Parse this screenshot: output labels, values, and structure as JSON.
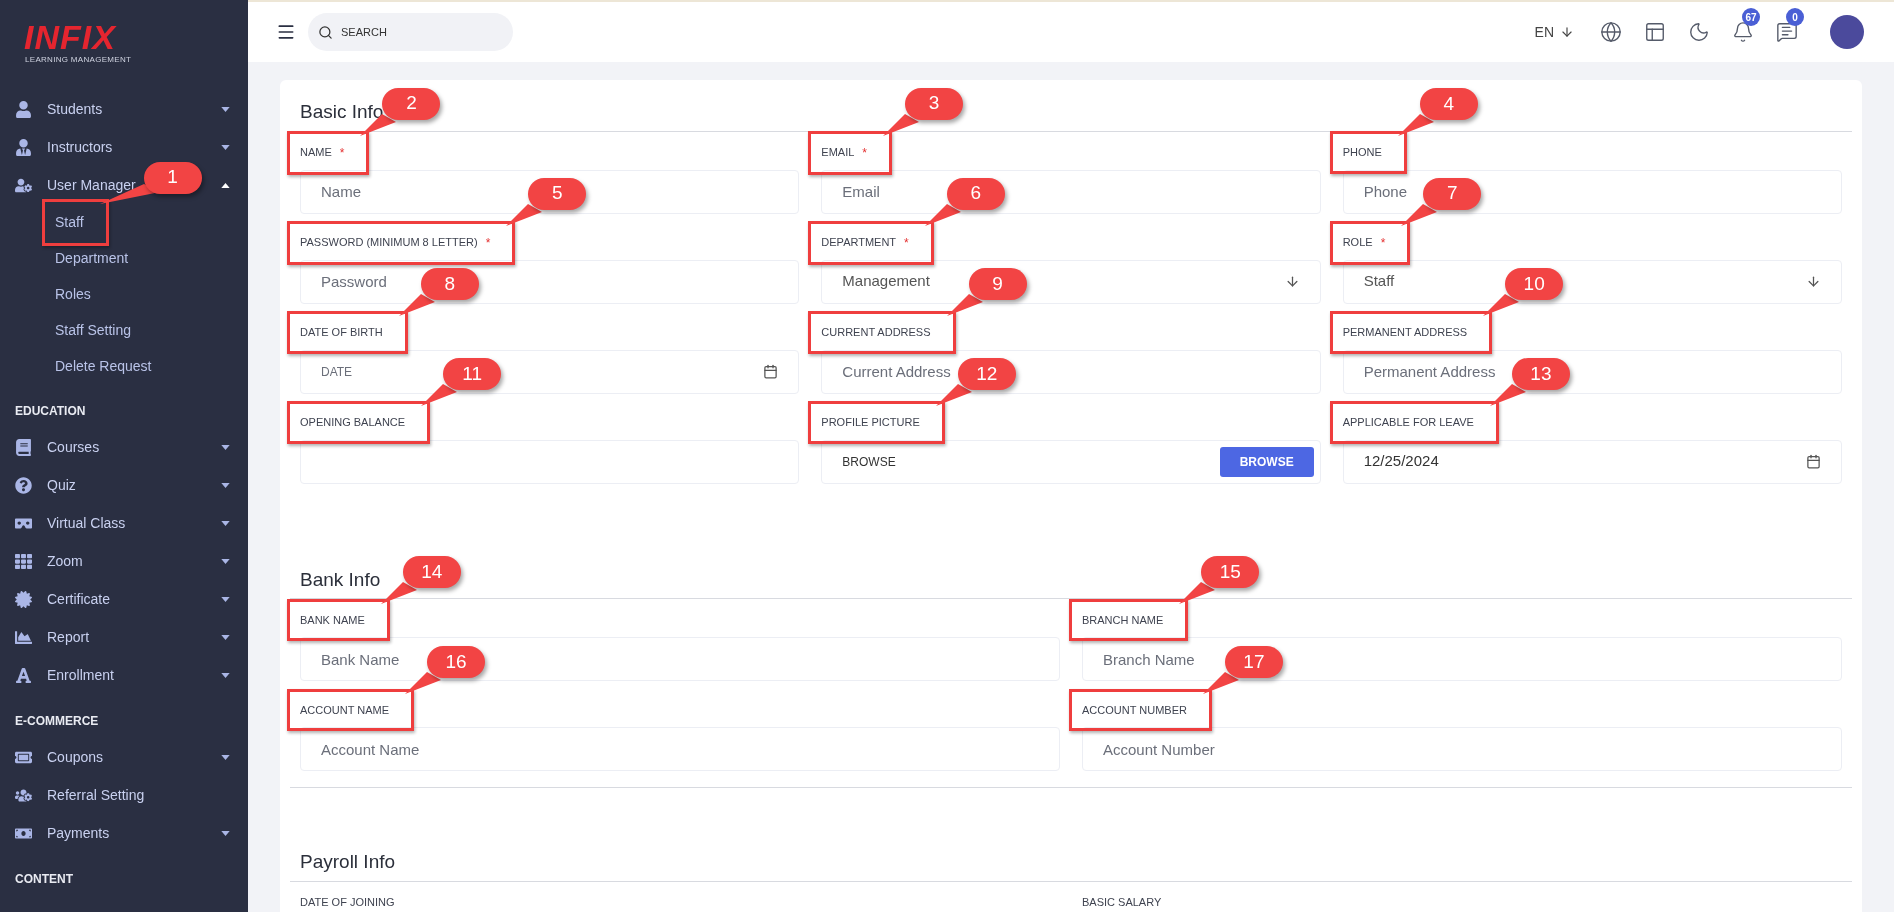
{
  "sidebar": {
    "logo": {
      "title": "INFIX",
      "subtitle": "LEARNING MANAGEMENT"
    },
    "items": [
      {
        "kind": "menu",
        "label": "Students",
        "expanded": false
      },
      {
        "kind": "menu",
        "label": "Instructors",
        "expanded": false
      },
      {
        "kind": "menu",
        "label": "User Manager",
        "expanded": true
      },
      {
        "kind": "subitem",
        "label": "Staff",
        "callout": "1"
      },
      {
        "kind": "subitem",
        "label": "Department"
      },
      {
        "kind": "subitem",
        "label": "Roles"
      },
      {
        "kind": "subitem",
        "label": "Staff Setting"
      },
      {
        "kind": "subitem",
        "label": "Delete Request"
      },
      {
        "kind": "heading",
        "label": "EDUCATION"
      },
      {
        "kind": "menu",
        "label": "Courses",
        "expanded": false
      },
      {
        "kind": "menu",
        "label": "Quiz",
        "expanded": false
      },
      {
        "kind": "menu",
        "label": "Virtual Class",
        "expanded": false
      },
      {
        "kind": "menu",
        "label": "Zoom",
        "expanded": false
      },
      {
        "kind": "menu",
        "label": "Certificate",
        "expanded": false
      },
      {
        "kind": "menu",
        "label": "Report",
        "expanded": false
      },
      {
        "kind": "menu",
        "label": "Enrollment",
        "expanded": false
      },
      {
        "kind": "heading",
        "label": "E-COMMERCE"
      },
      {
        "kind": "menu",
        "label": "Coupons",
        "expanded": false
      },
      {
        "kind": "link",
        "label": "Referral Setting"
      },
      {
        "kind": "menu",
        "label": "Payments",
        "expanded": false
      },
      {
        "kind": "heading",
        "label": "CONTENT"
      }
    ]
  },
  "topbar": {
    "search": {
      "placeholder": "SEARCH"
    },
    "language": "EN",
    "notifications": "67",
    "messages": "0"
  },
  "sections": [
    {
      "title": "Basic Info",
      "fields": [
        {
          "kind": "text",
          "label": "NAME",
          "required_mark": "*",
          "placeholder": "Name",
          "callout": "2"
        },
        {
          "kind": "text",
          "label": "EMAIL",
          "required_mark": "*",
          "placeholder": "Email",
          "callout": "3"
        },
        {
          "kind": "text",
          "label": "PHONE",
          "placeholder": "Phone",
          "callout": "4"
        },
        {
          "kind": "text",
          "label": "PASSWORD (MINIMUM 8 LETTER)",
          "required_mark": "*",
          "placeholder": "Password",
          "callout": "5"
        },
        {
          "kind": "select",
          "label": "DEPARTMENT",
          "required_mark": "*",
          "value": "Management",
          "callout": "6"
        },
        {
          "kind": "select",
          "label": "ROLE",
          "required_mark": "*",
          "value": "Staff",
          "callout": "7"
        },
        {
          "kind": "date",
          "label": "DATE OF BIRTH",
          "placeholder": "DATE",
          "callout": "8"
        },
        {
          "kind": "text",
          "label": "CURRENT ADDRESS",
          "placeholder": "Current Address",
          "callout": "9"
        },
        {
          "kind": "text",
          "label": "PERMANENT ADDRESS",
          "placeholder": "Permanent Address",
          "callout": "10"
        },
        {
          "kind": "text",
          "label": "OPENING BALANCE",
          "callout": "11"
        },
        {
          "kind": "file",
          "label": "PROFILE PICTURE",
          "placeholder": "BROWSE",
          "button": "BROWSE",
          "callout": "12"
        },
        {
          "kind": "date",
          "label": "APPLICABLE FOR LEAVE",
          "value": "12/25/2024",
          "callout": "13"
        }
      ]
    },
    {
      "title": "Bank Info",
      "fields": [
        {
          "kind": "text",
          "label": "BANK NAME",
          "placeholder": "Bank Name",
          "callout": "14"
        },
        {
          "kind": "text",
          "label": "BRANCH NAME",
          "placeholder": "Branch Name",
          "callout": "15"
        },
        {
          "kind": "text",
          "label": "ACCOUNT NAME",
          "placeholder": "Account Name",
          "callout": "16"
        },
        {
          "kind": "text",
          "label": "ACCOUNT NUMBER",
          "placeholder": "Account Number",
          "callout": "17"
        }
      ]
    },
    {
      "title": "Payroll Info",
      "fields": [
        {
          "kind": "label",
          "label": "DATE OF JOINING"
        },
        {
          "kind": "label",
          "label": "BASIC SALARY"
        }
      ]
    }
  ]
}
